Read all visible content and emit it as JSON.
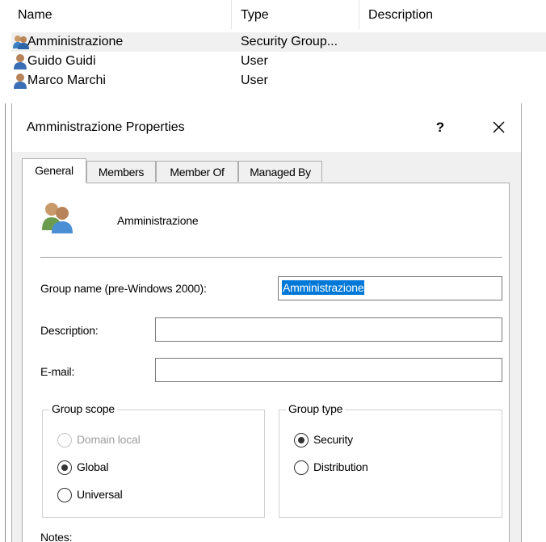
{
  "list": {
    "columns": {
      "name": "Name",
      "type": "Type",
      "description": "Description"
    },
    "rows": [
      {
        "name": "Amministrazione",
        "type": "Security Group...",
        "icon": "group-icon",
        "selected": true
      },
      {
        "name": "Guido Guidi",
        "type": "User",
        "icon": "user-icon",
        "selected": false
      },
      {
        "name": "Marco Marchi",
        "type": "User",
        "icon": "user-icon",
        "selected": false
      }
    ]
  },
  "dialog": {
    "title": "Amministrazione Properties",
    "help": "?",
    "tabs": [
      "General",
      "Members",
      "Member Of",
      "Managed By"
    ],
    "active_tab": "General",
    "group_display_name": "Amministrazione",
    "fields": {
      "group_name_label": "Group name (pre-Windows 2000):",
      "group_name_value": "Amministrazione",
      "description_label": "Description:",
      "description_value": "",
      "email_label": "E-mail:",
      "email_value": ""
    },
    "group_scope": {
      "legend": "Group scope",
      "options": [
        {
          "label": "Domain local",
          "checked": false,
          "disabled": true
        },
        {
          "label": "Global",
          "checked": true,
          "disabled": false
        },
        {
          "label": "Universal",
          "checked": false,
          "disabled": false
        }
      ]
    },
    "group_type": {
      "legend": "Group type",
      "options": [
        {
          "label": "Security",
          "checked": true
        },
        {
          "label": "Distribution",
          "checked": false
        }
      ]
    },
    "notes_label": "Notes:"
  },
  "colors": {
    "selection": "#0078d7",
    "dialog_bg": "#f0f0f0",
    "row_selected": "#f0f0f0"
  }
}
